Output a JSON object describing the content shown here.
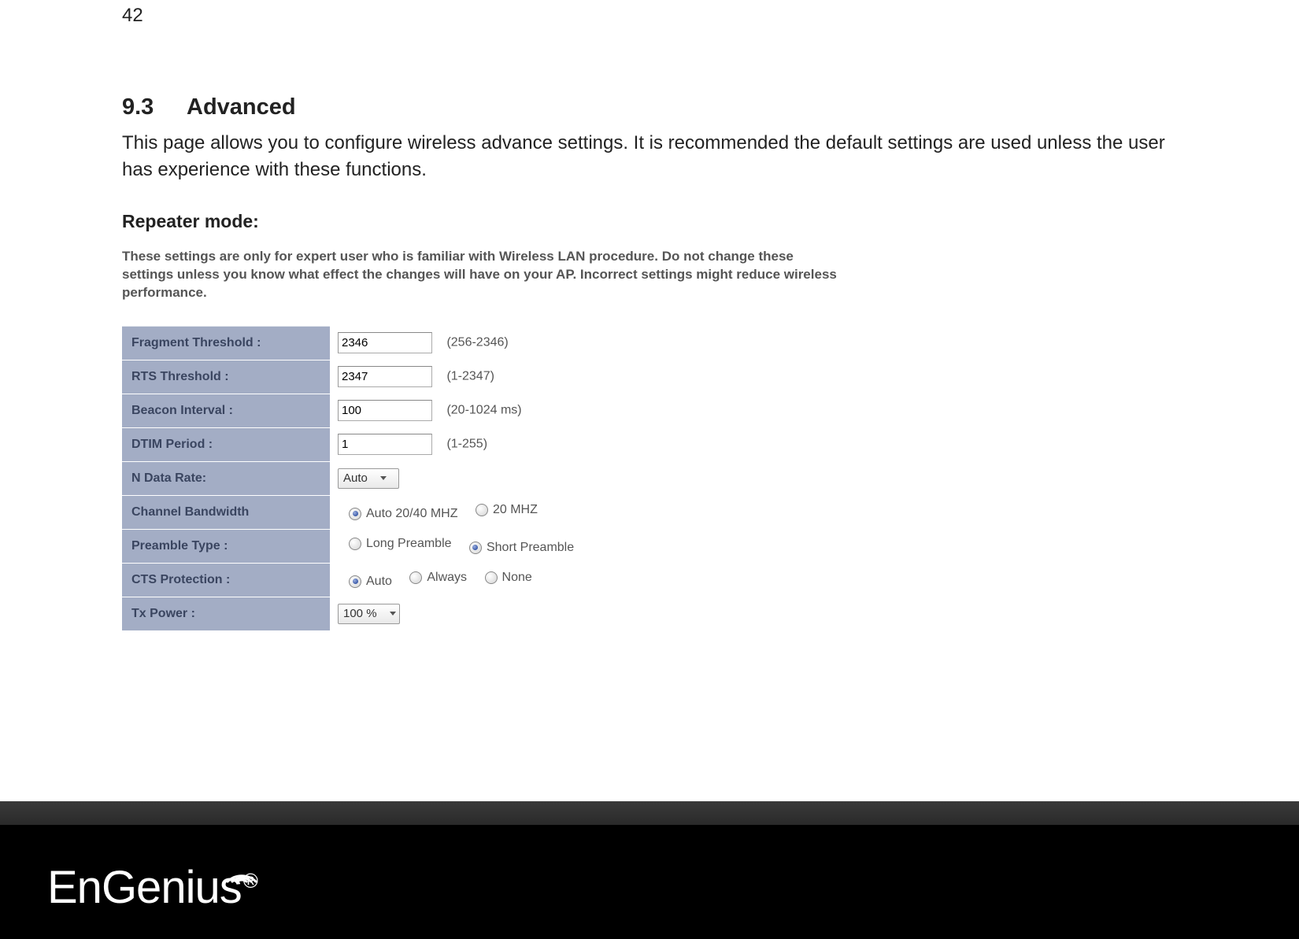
{
  "page_number": "42",
  "section": {
    "number": "9.3",
    "title": "Advanced"
  },
  "intro": "This page allows you to configure wireless advance settings. It is recommended the default settings are used unless the user has experience with these functions.",
  "sub_heading": "Repeater mode:",
  "warning_text": "These settings are only for expert user who is familiar with Wireless LAN procedure. Do not change these settings unless you know what effect the changes will have on your AP. Incorrect settings might reduce wireless performance.",
  "rows": {
    "fragment": {
      "label": "Fragment Threshold :",
      "value": "2346",
      "hint": "(256-2346)"
    },
    "rts": {
      "label": "RTS Threshold :",
      "value": "2347",
      "hint": "(1-2347)"
    },
    "beacon": {
      "label": "Beacon Interval :",
      "value": "100",
      "hint": "(20-1024 ms)"
    },
    "dtim": {
      "label": "DTIM Period :",
      "value": "1",
      "hint": "(1-255)"
    },
    "ndata": {
      "label": "N Data Rate:",
      "value": "Auto"
    },
    "chbw": {
      "label": "Channel Bandwidth",
      "options": [
        {
          "label": "Auto 20/40 MHZ",
          "checked": true
        },
        {
          "label": "20 MHZ",
          "checked": false
        }
      ]
    },
    "preamble": {
      "label": "Preamble Type :",
      "options": [
        {
          "label": "Long Preamble",
          "checked": false
        },
        {
          "label": "Short Preamble",
          "checked": true
        }
      ]
    },
    "cts": {
      "label": "CTS Protection :",
      "options": [
        {
          "label": "Auto",
          "checked": true
        },
        {
          "label": "Always",
          "checked": false
        },
        {
          "label": "None",
          "checked": false
        }
      ]
    },
    "txpower": {
      "label": "Tx Power :",
      "value": "100 %"
    }
  },
  "brand": {
    "name": "EnGenius",
    "reg": "®"
  }
}
